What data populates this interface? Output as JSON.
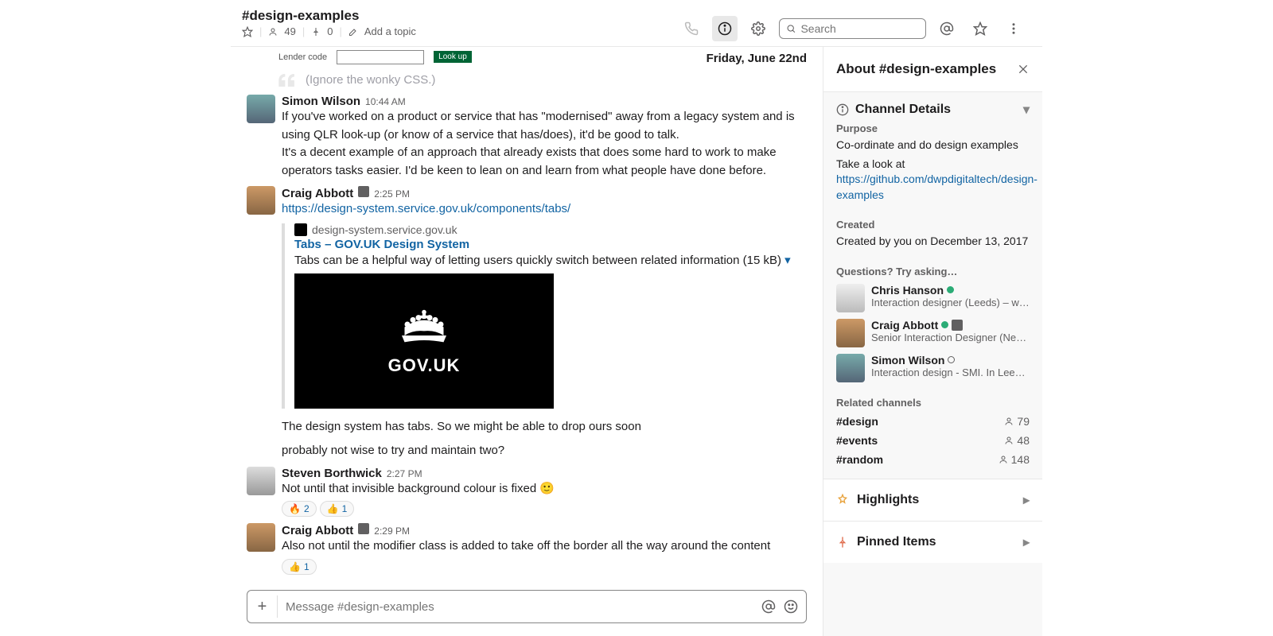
{
  "header": {
    "channel": "#design-examples",
    "members": "49",
    "pins": "0",
    "topic_prompt": "Add a topic",
    "search_placeholder": "Search"
  },
  "date": "Friday, June 22nd",
  "legacy_label": "Lender code",
  "legacy_button": "Look up",
  "quote": "(Ignore the wonky CSS.)",
  "messages": {
    "m1": {
      "author": "Simon Wilson",
      "time": "10:44 AM",
      "p1": "If you've worked on a product or service that has \"modernised\" away from a legacy system and is using QLR look-up (or know of a service that has/does), it'd be good to talk.",
      "p2": "It's a decent example of an approach that already exists that does some hard to work to make operators tasks easier. I'd be keen to lean on and learn from what people have done before."
    },
    "m2": {
      "author": "Craig Abbott",
      "time": "2:25 PM",
      "link": "https://design-system.service.gov.uk/components/tabs/",
      "site": "design-system.service.gov.uk",
      "title": "Tabs – GOV.UK Design System",
      "desc": "Tabs can be a helpful way of letting users quickly switch between related information (15 kB)",
      "preview": "GOV.UK",
      "p3": "The design system has tabs. So we might be able to drop ours soon",
      "p4": "probably not wise to try and maintain two?"
    },
    "m3": {
      "author": "Steven Borthwick",
      "time": "2:27 PM",
      "text": "Not until that invisible background colour is fixed 🙂",
      "r1": "🔥",
      "r1c": "2",
      "r2": "👍",
      "r2c": "1"
    },
    "m4": {
      "author": "Craig Abbott",
      "time": "2:29 PM",
      "text": "Also not until the modifier class is added to take off the border all the way around the content",
      "r1": "👍",
      "r1c": "1"
    }
  },
  "compose": {
    "placeholder": "Message #design-examples"
  },
  "sidebar": {
    "title": "About #design-examples",
    "details_title": "Channel Details",
    "purpose_label": "Purpose",
    "purpose": "Co-ordinate and do design examples",
    "link_intro": "Take a look at ",
    "link": "https://github.com/dwpdigitaltech/design-examples",
    "created_label": "Created",
    "created": "Created by you on December 13, 2017",
    "questions_label": "Questions? Try asking…",
    "p1_name": "Chris Hanson",
    "p1_role": "Interaction designer (Leeds) – wo…",
    "p2_name": "Craig Abbott",
    "p2_role": "Senior Interaction Designer (New…",
    "p3_name": "Simon Wilson",
    "p3_role": "Interaction design - SMI. In Leeds…",
    "related_label": "Related channels",
    "c1": "#design",
    "c1n": "79",
    "c2": "#events",
    "c2n": "48",
    "c3": "#random",
    "c3n": "148",
    "highlights": "Highlights",
    "pinned": "Pinned Items"
  }
}
